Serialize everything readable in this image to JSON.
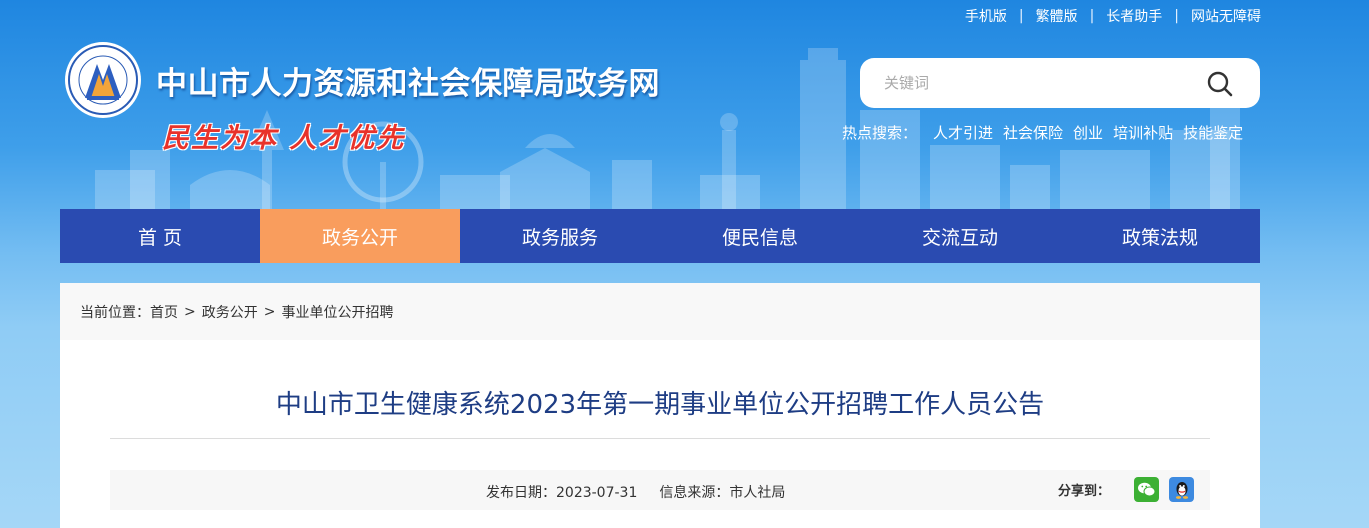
{
  "top_links": [
    "手机版",
    "繁體版",
    "长者助手",
    "网站无障碍"
  ],
  "header": {
    "title": "中山市人力资源和社会保障局政务网",
    "slogan": "民生为本 人才优先"
  },
  "search": {
    "placeholder": "关键词",
    "hotwords_label": "热点搜索：",
    "hotwords": [
      "人才引进",
      "社会保险",
      "创业",
      "培训补贴",
      "技能鉴定"
    ]
  },
  "nav": {
    "active_index": 1,
    "items": [
      "首 页",
      "政务公开",
      "政务服务",
      "便民信息",
      "交流互动",
      "政策法规"
    ]
  },
  "breadcrumb": {
    "label": "当前位置：",
    "separator": ">",
    "items": [
      "首页",
      "政务公开",
      "事业单位公开招聘"
    ]
  },
  "article": {
    "title": "中山市卫生健康系统2023年第一期事业单位公开招聘工作人员公告",
    "date_label": "发布日期：",
    "date": "2023-07-31",
    "source_label": "信息来源：",
    "source": "市人社局",
    "share_label": "分享到："
  },
  "colors": {
    "nav_bg": "#2a4bb1",
    "nav_active": "#f99d5d",
    "title": "#1e3d84",
    "slogan": "#e8322a"
  }
}
